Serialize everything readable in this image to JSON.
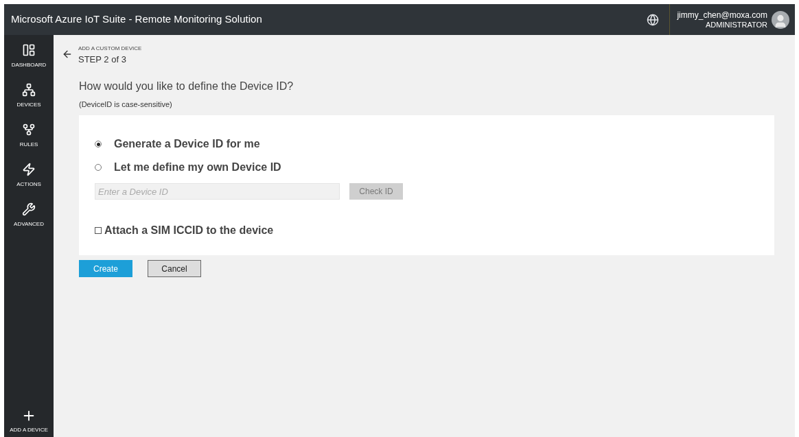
{
  "header": {
    "title": "Microsoft Azure IoT Suite - Remote Monitoring Solution",
    "user": {
      "email": "jimmy_chen@moxa.com",
      "role": "ADMINISTRATOR"
    }
  },
  "sidebar": {
    "items": [
      {
        "label": "DASHBOARD",
        "kind": "dashboard"
      },
      {
        "label": "DEVICES",
        "kind": "devices"
      },
      {
        "label": "RULES",
        "kind": "rules"
      },
      {
        "label": "ACTIONS",
        "kind": "actions"
      },
      {
        "label": "ADVANCED",
        "kind": "advanced"
      }
    ],
    "bottom_item": {
      "label": "ADD A DEVICE"
    }
  },
  "page": {
    "breadcrumb": "ADD A CUSTOM DEVICE",
    "step": "STEP 2 of 3",
    "question": "How would you like to define the Device ID?",
    "note": "(DeviceID is case-sensitive)"
  },
  "form": {
    "options": [
      {
        "label": "Generate a Device ID for me",
        "selected": true
      },
      {
        "label": "Let me define my own Device ID",
        "selected": false
      }
    ],
    "device_id_field": {
      "placeholder": "Enter a Device ID"
    },
    "check_button": {
      "label": "Check ID",
      "disabled": true
    },
    "sim_checkbox": {
      "label": "Attach a SIM ICCID to the device",
      "checked": false
    }
  },
  "buttons": {
    "create": "Create",
    "cancel": "Cancel"
  }
}
